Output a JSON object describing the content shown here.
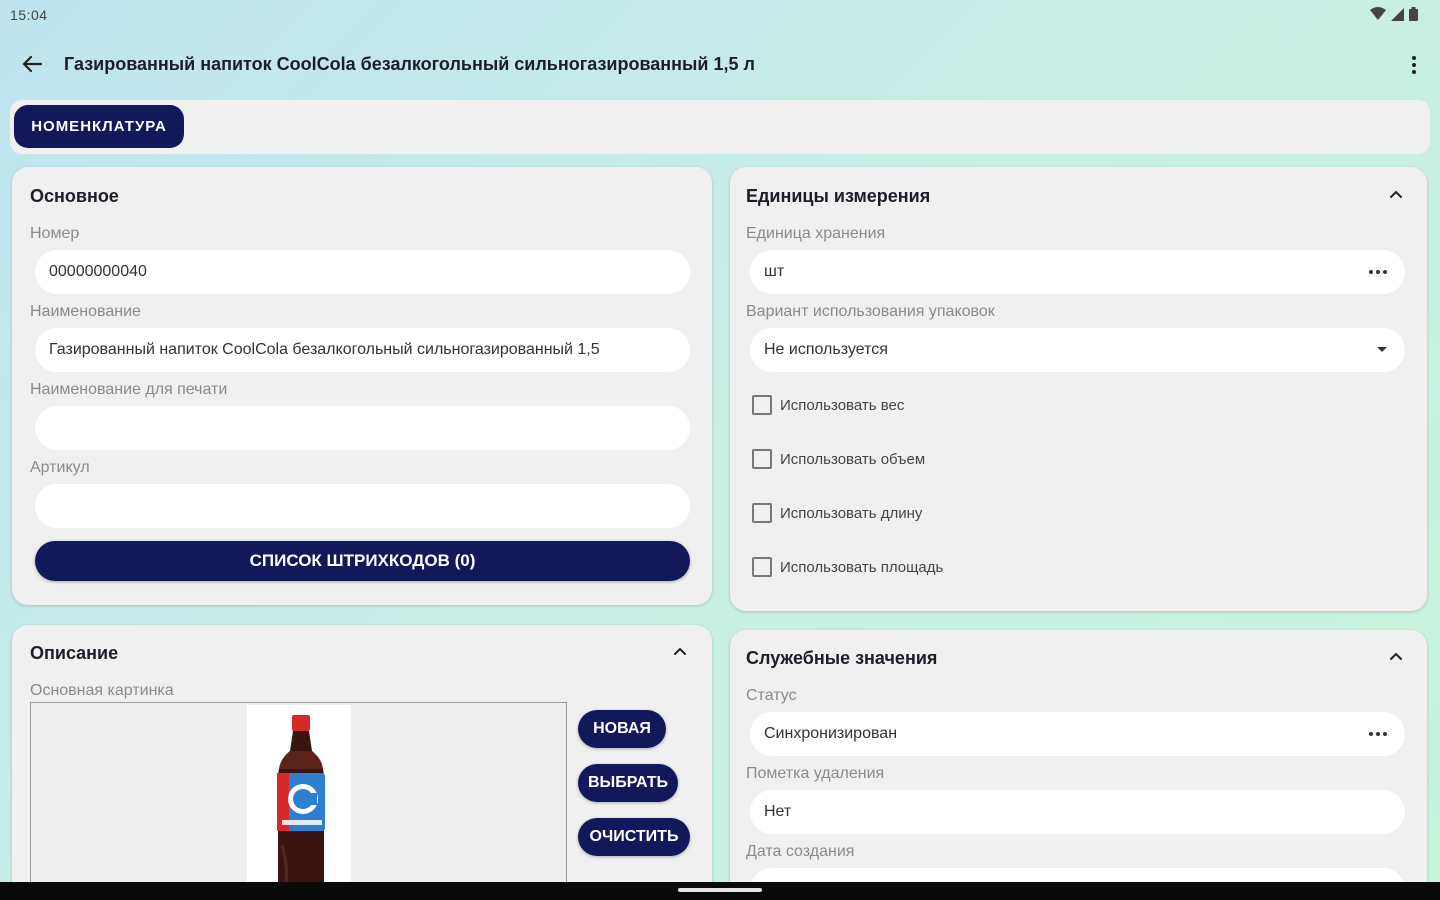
{
  "status": {
    "time": "15:04"
  },
  "appbar": {
    "title": "Газированный напиток CoolCola безалкогольный сильногазированный 1,5 л"
  },
  "tabs": [
    {
      "label": "НОМЕНКЛАТУРА"
    }
  ],
  "main_card": {
    "title": "Основное",
    "number_label": "Номер",
    "number_value": "00000000040",
    "name_label": "Наименование",
    "name_value": "Газированный напиток CoolCola безалкогольный сильногазированный 1,5",
    "print_name_label": "Наименование для печати",
    "print_name_value": "",
    "article_label": "Артикул",
    "article_value": "",
    "barcodes_button": "СПИСОК ШТРИХКОДОВ (0)"
  },
  "units_card": {
    "title": "Единицы измерения",
    "storage_unit_label": "Единица хранения",
    "storage_unit_value": "шт",
    "packaging_label": "Вариант использования упаковок",
    "packaging_value": "Не используется",
    "checkboxes": [
      {
        "label": "Использовать вес",
        "checked": false
      },
      {
        "label": "Использовать объем",
        "checked": false
      },
      {
        "label": "Использовать длину",
        "checked": false
      },
      {
        "label": "Использовать площадь",
        "checked": false
      }
    ]
  },
  "description_card": {
    "title": "Описание",
    "image_label": "Основная картинка",
    "new_button": "НОВАЯ",
    "choose_button": "ВЫБРАТЬ",
    "clear_button": "ОЧИСТИТЬ"
  },
  "service_card": {
    "title": "Служебные значения",
    "status_label": "Статус",
    "status_value": "Синхронизирован",
    "deletion_label": "Пометка удаления",
    "deletion_value": "Нет",
    "created_label": "Дата создания"
  },
  "colors": {
    "accent": "#12195a",
    "card_bg": "#f0f0f0",
    "field_bg": "#ffffff",
    "bottle_cap": "#d42a2a",
    "bottle_liquid": "#3a1410",
    "bottle_label": "#2f7fd0"
  }
}
